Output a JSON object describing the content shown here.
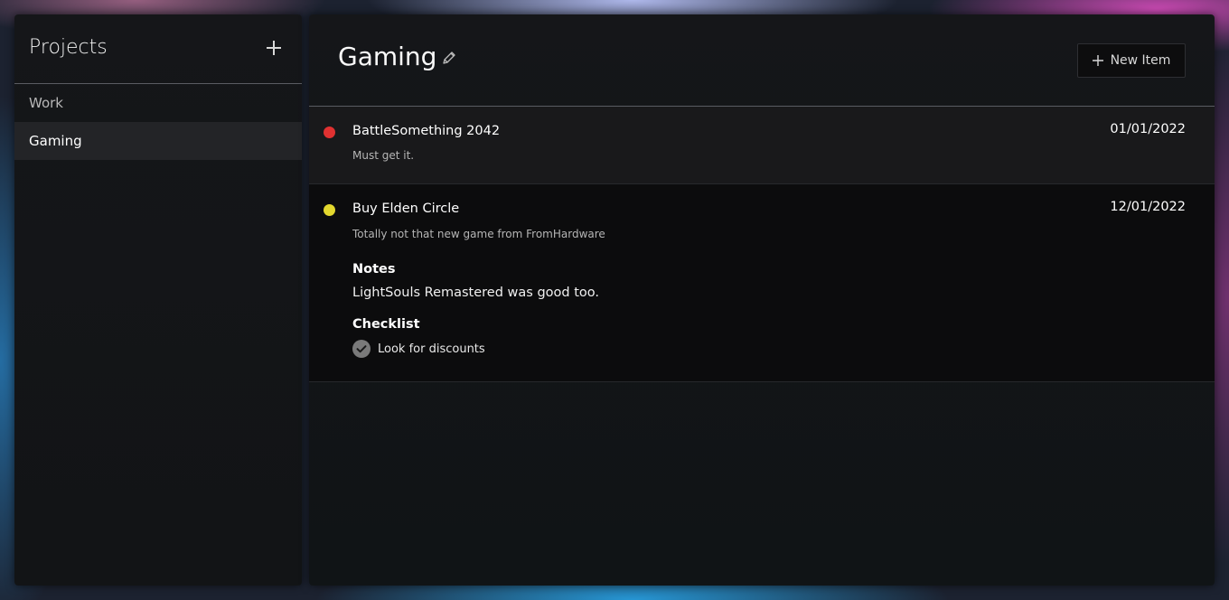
{
  "sidebar": {
    "title": "Projects",
    "items": [
      {
        "label": "Work",
        "active": false
      },
      {
        "label": "Gaming",
        "active": true
      }
    ]
  },
  "main": {
    "title": "Gaming",
    "new_item_label": "New Item",
    "items": [
      {
        "title": "BattleSomething 2042",
        "subtitle": "Must get it.",
        "date": "01/01/2022",
        "status_color": "#e03131"
      },
      {
        "title": "Buy Elden Circle",
        "subtitle": "Totally not that new game from FromHardware",
        "date": "12/01/2022",
        "status_color": "#e3d82e",
        "notes_heading": "Notes",
        "notes": "LightSouls Remastered was good too.",
        "checklist_heading": "Checklist",
        "checklist": [
          {
            "label": "Look for discounts",
            "checked": true
          }
        ]
      }
    ]
  },
  "icons": {
    "add": "plus-icon",
    "edit": "pencil-icon",
    "check": "check-circle-icon"
  }
}
